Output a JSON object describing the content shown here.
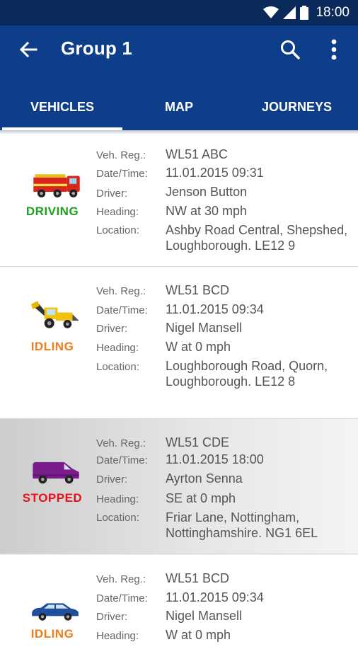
{
  "status_bar": {
    "time": "18:00"
  },
  "header": {
    "title": "Group 1"
  },
  "tabs": [
    {
      "label": "VEHICLES"
    },
    {
      "label": "MAP"
    },
    {
      "label": "JOURNEYS"
    }
  ],
  "field_labels": {
    "reg": "Veh. Reg.:",
    "datetime": "Date/Time:",
    "driver": "Driver:",
    "heading": "Heading:",
    "location": "Location:"
  },
  "vehicles": [
    {
      "icon": "fire-engine-icon",
      "status": "DRIVING",
      "status_color": "#1fa11f",
      "reg": "WL51 ABC",
      "datetime": "11.01.2015  09:31",
      "driver": "Jenson Button",
      "heading": "NW at 30 mph",
      "location_line1": "Ashby Road Central, Shepshed,",
      "location_line2": "Loughborough. LE12 9"
    },
    {
      "icon": "digger-icon",
      "status": "IDLING",
      "status_color": "#f07d1a",
      "reg": "WL51 BCD",
      "datetime": "11.01.2015  09:34",
      "driver": "Nigel Mansell",
      "heading": "W at 0 mph",
      "location_line1": "Loughborough Road, Quorn,",
      "location_line2": "Loughborough. LE12 8"
    },
    {
      "icon": "van-icon",
      "status": "STOPPED",
      "status_color": "#e8111b",
      "reg": "WL51 CDE",
      "datetime": "11.01.2015  18:00",
      "driver": "Ayrton Senna",
      "heading": "SE at 0 mph",
      "location_line1": "Friar Lane, Nottingham,",
      "location_line2": "Nottinghamshire. NG1 6EL"
    },
    {
      "icon": "car-icon",
      "status": "IDLING",
      "status_color": "#f07d1a",
      "reg": "WL51 BCD",
      "datetime": "11.01.2015  09:34",
      "driver": "Nigel Mansell",
      "heading": "W at 0 mph"
    }
  ]
}
